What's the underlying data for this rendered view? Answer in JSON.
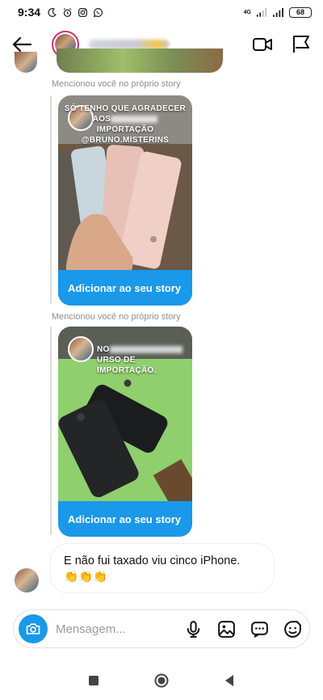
{
  "status_bar": {
    "time": "9:34",
    "network": "4G",
    "battery": "68",
    "icons": [
      "moon-icon",
      "alarm-icon",
      "instagram-icon",
      "whatsapp-icon",
      "wifi-icon",
      "signal-icon",
      "battery-icon"
    ]
  },
  "header": {
    "icons": [
      "back-arrow-icon",
      "video-call-icon",
      "flag-icon"
    ]
  },
  "thread": {
    "stories": [
      {
        "mention": "Mencionou você no próprio story",
        "caption_lines": [
          "SÓ TENHO QUE AGRADECER",
          "AOS",
          "IMPORTAÇÃO",
          "@BRUNO.MISTERINS"
        ],
        "button": "Adicionar ao seu story"
      },
      {
        "mention": "Mencionou você no próprio story",
        "caption_lines": [
          "NO",
          "URSO DE IMPORTAÇÃO."
        ],
        "button": "Adicionar ao seu story"
      }
    ],
    "message": {
      "text": "E não fui taxado viu cinco iPhone.",
      "emoji": "👏👏👏"
    }
  },
  "composer": {
    "placeholder": "Mensagem...",
    "icons": [
      "camera-icon",
      "microphone-icon",
      "gallery-icon",
      "chat-dots-icon",
      "sticker-icon"
    ]
  },
  "nav": {
    "icons": [
      "recent-apps-icon",
      "home-icon",
      "back-icon"
    ]
  },
  "colors": {
    "accent": "#1a98ea",
    "story_ring": "#d62976",
    "muted_text": "#8e8e8e"
  }
}
